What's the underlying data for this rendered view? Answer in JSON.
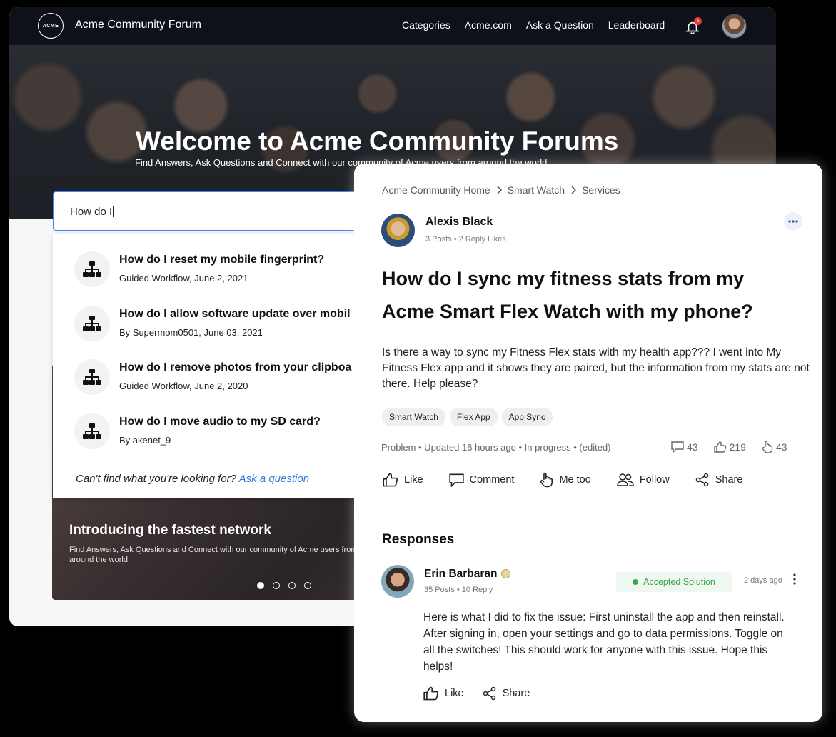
{
  "nav": {
    "logo": "ACME",
    "brand": "Acme Community Forum",
    "links": [
      "Categories",
      "Acme.com",
      "Ask a Question",
      "Leaderboard"
    ],
    "notification_count": "5"
  },
  "hero": {
    "title": "Welcome to Acme Community Forums",
    "subtitle": "Find Answers, Ask Questions and Connect with our community of Acme users from around the world."
  },
  "search": {
    "value": "How do I"
  },
  "suggestions": [
    {
      "title": "How do I reset my mobile fingerprint?",
      "meta": "Guided Workflow, June 2, 2021"
    },
    {
      "title": "How do I allow software update over mobil",
      "meta": "By Supermom0501, June 03, 2021"
    },
    {
      "title": "How do I remove photos from your clipboa",
      "meta": "Guided Workflow, June 2, 2020"
    },
    {
      "title": "How do I move audio to my SD card?",
      "meta": "By akenet_9"
    }
  ],
  "dropdown_footer": {
    "text": "Can't find what you're looking for?",
    "link": "Ask a question"
  },
  "promo": {
    "title": "Introducing the fastest network",
    "subtitle": "Find Answers, Ask Questions and Connect with our community of Acme users from around the world.",
    "slides": 4,
    "active_slide": 1
  },
  "post": {
    "breadcrumbs": [
      "Acme Community Home",
      "Smart Watch",
      "Services"
    ],
    "author": {
      "name": "Alexis Black",
      "posts": "3 Posts",
      "likes": "2 Reply Likes"
    },
    "title": "How do I sync my fitness stats from my Acme Smart Flex Watch with my phone?",
    "body": "Is there a way to sync my Fitness Flex stats with my health app??? I went into My Fitness Flex app and it shows they are paired, but the information from my stats are not there. Help please?",
    "tags": [
      "Smart Watch",
      "Flex App",
      "App Sync"
    ],
    "status": "Problem  •  Updated 16 hours ago  •  In progress  •  (edited)",
    "stats": {
      "comments": "43",
      "likes": "219",
      "me_too": "43"
    },
    "actions": [
      "Like",
      "Comment",
      "Me too",
      "Follow",
      "Share"
    ]
  },
  "responses": {
    "heading": "Responses",
    "items": [
      {
        "name": "Erin Barbaran",
        "posts": "35 Posts",
        "replies": "10 Reply",
        "badge": "Accepted Solution",
        "time": "2 days ago",
        "body": "Here is what I did to fix the issue: First uninstall the app and then reinstall. After signing in, open your settings and go to data permissions.  Toggle on all the switches! This should work for anyone with this issue. Hope this helps!",
        "actions": [
          "Like",
          "Share"
        ]
      }
    ]
  },
  "colors": {
    "accent": "#2f7bd9",
    "success": "#3aa54a",
    "nav_bg": "#0f111a"
  }
}
